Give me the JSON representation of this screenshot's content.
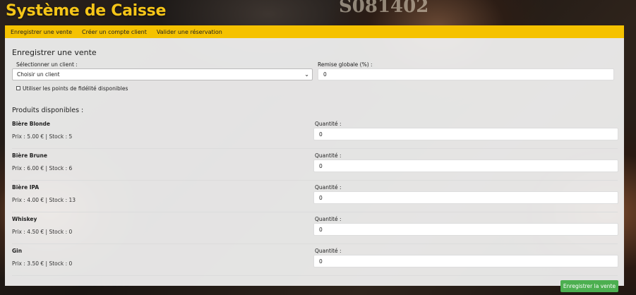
{
  "app": {
    "title": "Système de Caisse"
  },
  "nav": [
    {
      "label": "Enregistrer une vente"
    },
    {
      "label": "Créer un compte client"
    },
    {
      "label": "Valider une réservation"
    }
  ],
  "form": {
    "title": "Enregistrer une vente",
    "client_label": "Sélectionner un client :",
    "client_selected": "Choisir un client",
    "discount_label": "Remise globale (%) :",
    "discount_value": "0",
    "loyalty_label": "Utiliser les points de fidélité disponibles",
    "loyalty_checked": false
  },
  "products": {
    "title": "Produits disponibles :",
    "quantity_label": "Quantité :",
    "items": [
      {
        "name": "Bière Blonde",
        "info": "Prix : 5.00 € | Stock : 5",
        "quantity": "0"
      },
      {
        "name": "Bière Brune",
        "info": "Prix : 6.00 € | Stock : 6",
        "quantity": "0"
      },
      {
        "name": "Bière IPA",
        "info": "Prix : 4.00 € | Stock : 13",
        "quantity": "0"
      },
      {
        "name": "Whiskey",
        "info": "Prix : 4.50 € | Stock : 0",
        "quantity": "0"
      },
      {
        "name": "Gin",
        "info": "Prix : 3.50 € | Stock : 0",
        "quantity": "0"
      }
    ]
  },
  "submit_label": "Enregistrer la vente",
  "colors": {
    "accent": "#f5c200",
    "title": "#f5c518",
    "submit": "#4caf50"
  }
}
